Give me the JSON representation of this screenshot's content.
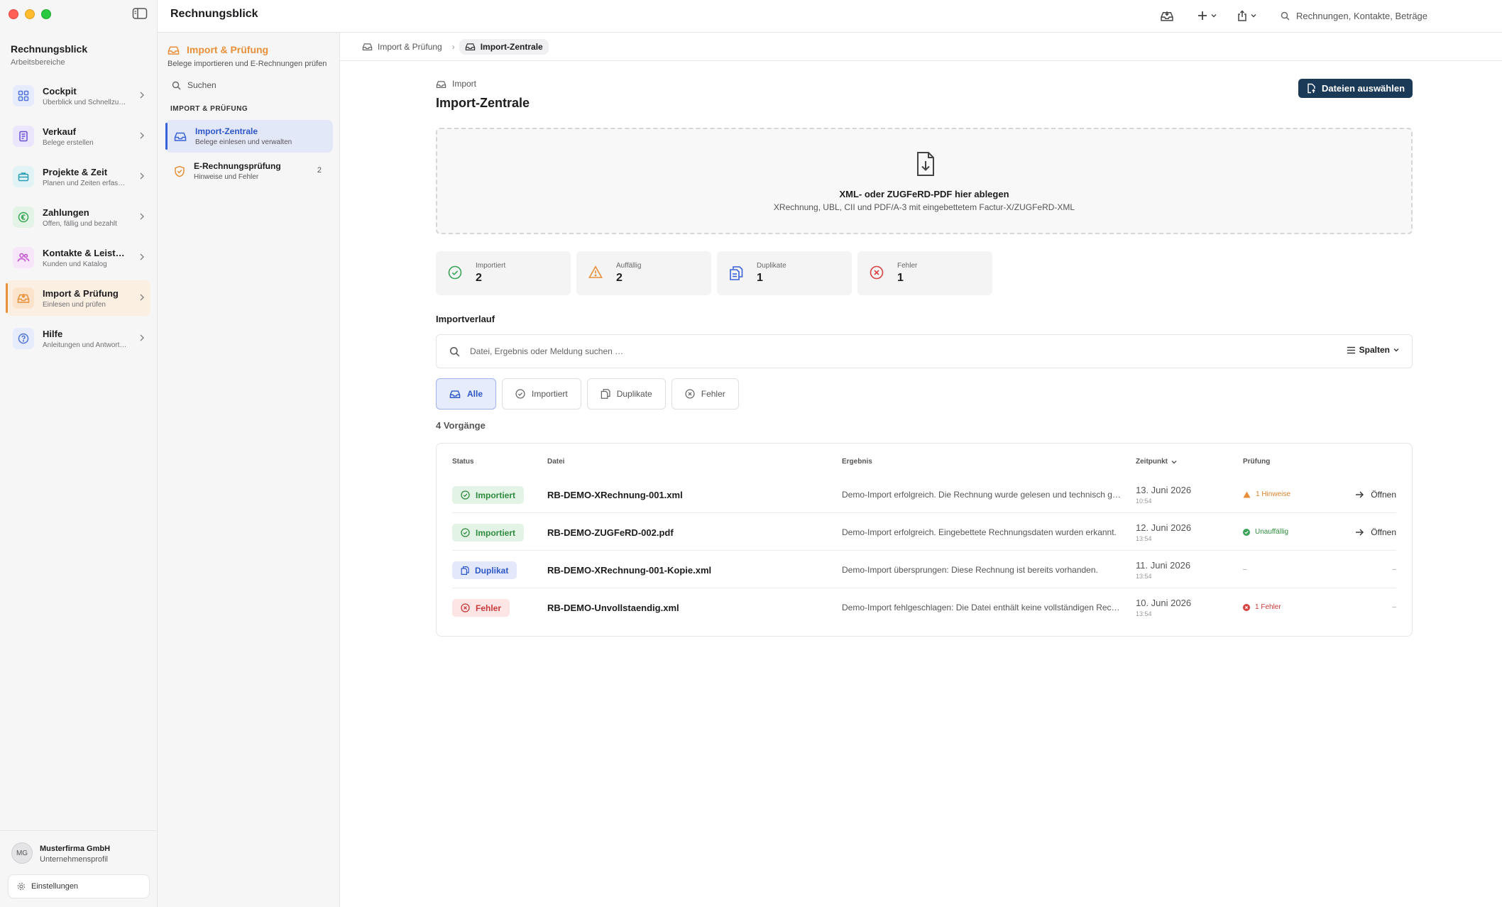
{
  "app": {
    "title": "Rechnungsblick"
  },
  "sidebar": {
    "title": "Rechnungsblick",
    "subtitle": "Arbeitsbereiche",
    "items": [
      {
        "label": "Cockpit",
        "sub": "Überblick und Schnellzu…",
        "icon": "grid-icon",
        "color": "#4f73d9"
      },
      {
        "label": "Verkauf",
        "sub": "Belege erstellen",
        "icon": "document-icon",
        "color": "#6b4fd9"
      },
      {
        "label": "Projekte & Zeit",
        "sub": "Planen und Zeiten erfass…",
        "icon": "briefcase-icon",
        "color": "#2a9db5"
      },
      {
        "label": "Zahlungen",
        "sub": "Offen, fällig und bezahlt",
        "icon": "euro-icon",
        "color": "#3aa457"
      },
      {
        "label": "Kontakte & Leistung…",
        "sub": "Kunden und Katalog",
        "icon": "people-icon",
        "color": "#c04fd0"
      },
      {
        "label": "Import & Prüfung",
        "sub": "Einlesen und prüfen",
        "icon": "inbox-icon",
        "color": "#e8903a"
      },
      {
        "label": "Hilfe",
        "sub": "Anleitungen und Antwort…",
        "icon": "help-icon",
        "color": "#4f73d9"
      }
    ],
    "company": {
      "initials": "MG",
      "name": "Musterfirma GmbH",
      "sub": "Unternehmensprofil"
    },
    "settings_label": "Einstellungen"
  },
  "panel": {
    "title": "Import & Prüfung",
    "subtitle": "Belege importieren und E-Rechnungen prüfen",
    "search_label": "Suchen",
    "section": "IMPORT & PRÜFUNG",
    "items": [
      {
        "label": "Import-Zentrale",
        "sub": "Belege einlesen und verwalten",
        "count": ""
      },
      {
        "label": "E-Rechnungsprüfung",
        "sub": "Hinweise und Fehler",
        "count": "2"
      }
    ]
  },
  "topbar": {
    "search_placeholder": "Rechnungen, Kontakte, Beträge"
  },
  "breadcrumb": {
    "parent": "Import & Prüfung",
    "current": "Import-Zentrale"
  },
  "main": {
    "section_label": "Import",
    "title": "Import-Zentrale",
    "primary_button": "Dateien auswählen",
    "dropzone": {
      "title": "XML- oder ZUGFeRD-PDF hier ablegen",
      "subtitle": "XRechnung, UBL, CII und PDF/A-3 mit eingebettetem Factur-X/ZUGFeRD-XML"
    },
    "stats": [
      {
        "label": "Importiert",
        "value": "2",
        "color": "#3aa457"
      },
      {
        "label": "Auffällig",
        "value": "2",
        "color": "#e8903a"
      },
      {
        "label": "Duplikate",
        "value": "1",
        "color": "#3a62d8"
      },
      {
        "label": "Fehler",
        "value": "1",
        "color": "#d94040"
      }
    ],
    "history_title": "Importverlauf",
    "filter_placeholder": "Datei, Ergebnis oder Meldung suchen …",
    "columns_button": "Spalten",
    "chips": [
      "Alle",
      "Importiert",
      "Duplikate",
      "Fehler"
    ],
    "count_label": "4 Vorgänge",
    "table": {
      "headers": [
        "Status",
        "Datei",
        "Ergebnis",
        "Zeitpunkt",
        "Prüfung"
      ],
      "rows": [
        {
          "status": "Importiert",
          "file": "RB-DEMO-XRechnung-001.xml",
          "result": "Demo-Import erfolgreich. Die Rechnung wurde gelesen und technisch geprüft.",
          "date": "13. Juni 2026",
          "time": "10:54",
          "check": "1 Hinweise",
          "action": "Öffnen"
        },
        {
          "status": "Importiert",
          "file": "RB-DEMO-ZUGFeRD-002.pdf",
          "result": "Demo-Import erfolgreich. Eingebettete Rechnungsdaten wurden erkannt.",
          "date": "12. Juni 2026",
          "time": "13:54",
          "check": "Unauffällig",
          "action": "Öffnen"
        },
        {
          "status": "Duplikat",
          "file": "RB-DEMO-XRechnung-001-Kopie.xml",
          "result": "Demo-Import übersprungen: Diese Rechnung ist bereits vorhanden.",
          "date": "11. Juni 2026",
          "time": "13:54",
          "check": "–",
          "action": "–"
        },
        {
          "status": "Fehler",
          "file": "RB-DEMO-Unvollstaendig.xml",
          "result": "Demo-Import fehlgeschlagen: Die Datei enthält keine vollständigen Rechnungsdaten.",
          "date": "10. Juni 2026",
          "time": "13:54",
          "check": "1 Fehler",
          "action": "–"
        }
      ]
    }
  }
}
